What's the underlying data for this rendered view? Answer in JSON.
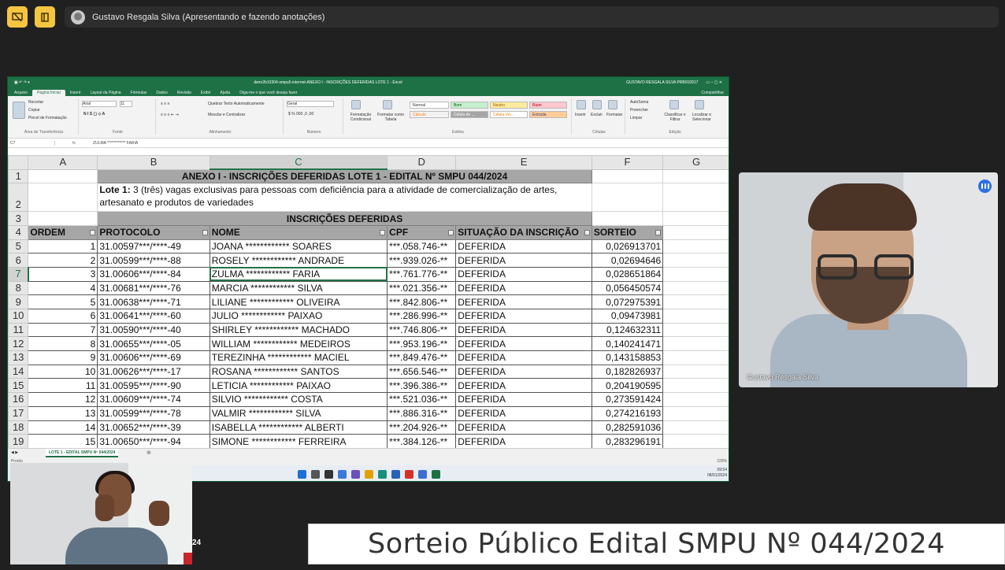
{
  "meeting": {
    "presenter_label": "Gustavo Resgala Silva (Apresentando e fazendo anotações)",
    "presenter_cam_name": "Gustavo Resgala Silva",
    "banner_text": "Sorteio Público Edital SMPU  Nº 044/2024",
    "side_label": "24"
  },
  "excel": {
    "title": "dsmr2b10304-smpu5-internet-ANEXO I - INSCRIÇÕES DEFERIDAS LOTE 1 - Excel",
    "user": "GUSTAVO RESGALA SILVA PRB010917",
    "tabs": [
      "Arquivo",
      "Página Inicial",
      "Inserir",
      "Layout da Página",
      "Fórmulas",
      "Dados",
      "Revisão",
      "Exibir",
      "Ajuda",
      "Diga-me o que você deseja fazer"
    ],
    "share": "Compartilhar",
    "ribbon": {
      "clipboard": [
        "Recortar",
        "Copiar",
        "Pincel de Formatação"
      ],
      "clipboard_cap": "Área de Transferência",
      "font_name": "Arial",
      "font_size": "11",
      "font_cap": "Fonte",
      "wrap": "Quebrar Texto Automaticamente",
      "merge": "Mesclar e Centralizar",
      "align_cap": "Alinhamento",
      "number_format": "Geral",
      "number_cap": "Número",
      "cond_format": "Formatação Condicional",
      "format_table": "Formatar como Tabela",
      "styles": [
        "Normal",
        "Bom",
        "Neutro",
        "Ruim",
        "Cálculo",
        "Célula de ...",
        "Célula Vin...",
        "Entrada"
      ],
      "styles_cap": "Estilos",
      "cells": [
        "Inserir",
        "Excluir",
        "Formatar"
      ],
      "cells_cap": "Células",
      "edit": [
        "AutoSoma",
        "Preencher",
        "Limpar",
        "Classificar e Filtrar",
        "Localizar e Selecionar"
      ],
      "edit_cap": "Edição"
    },
    "name_box": "C7",
    "fx": "fx",
    "formula": "ZULMA ************ FARIA",
    "columns": [
      "A",
      "B",
      "C",
      "D",
      "E",
      "F",
      "G"
    ],
    "row_numbers": [
      "1",
      "2",
      "3",
      "4",
      "5",
      "6",
      "7",
      "8",
      "9",
      "10",
      "11",
      "12",
      "13",
      "14",
      "15",
      "16",
      "17",
      "18",
      "19"
    ],
    "title_row": "ANEXO I - INSCRIÇÕES DEFERIDAS LOTE 1 - EDITAL Nº SMPU 044/2024",
    "lote_label": "Lote 1:",
    "lote_text": "3 (três) vagas exclusivas para pessoas com deficiência para a atividade de comercialização de artes, artesanato e produtos de variedades",
    "band": "INSCRIÇÕES DEFERIDAS",
    "headers": [
      "ORDEM",
      "PROTOCOLO",
      "NOME",
      "CPF",
      "SITUAÇÃO DA INSCRIÇÃO",
      "SORTEIO"
    ],
    "rows": [
      [
        "1",
        "31.00597***/****-49",
        "JOANA ************ SOARES",
        "***.058.746-**",
        "DEFERIDA",
        "0,026913701"
      ],
      [
        "2",
        "31.00599***/****-88",
        "ROSELY ************ ANDRADE",
        "***.939.026-**",
        "DEFERIDA",
        "0,02694646"
      ],
      [
        "3",
        "31.00606***/****-84",
        "ZULMA ************ FARIA",
        "***.761.776-**",
        "DEFERIDA",
        "0,028651864"
      ],
      [
        "4",
        "31.00681***/****-76",
        "MARCIA ************ SILVA",
        "***.021.356-**",
        "DEFERIDA",
        "0,056450574"
      ],
      [
        "5",
        "31.00638***/****-71",
        "LILIANE ************ OLIVEIRA",
        "***.842.806-**",
        "DEFERIDA",
        "0,072975391"
      ],
      [
        "6",
        "31.00641***/****-60",
        "JULIO ************ PAIXAO",
        "***.286.996-**",
        "DEFERIDA",
        "0,09473981"
      ],
      [
        "7",
        "31.00590***/****-40",
        "SHIRLEY ************ MACHADO",
        "***.746.806-**",
        "DEFERIDA",
        "0,124632311"
      ],
      [
        "8",
        "31.00655***/****-05",
        "WILLIAM ************ MEDEIROS",
        "***.953.196-**",
        "DEFERIDA",
        "0,140241471"
      ],
      [
        "9",
        "31.00606***/****-69",
        "TEREZINHA ************ MACIEL",
        "***.849.476-**",
        "DEFERIDA",
        "0,143158853"
      ],
      [
        "10",
        "31.00626***/****-17",
        "ROSANA ************ SANTOS",
        "***.656.546-**",
        "DEFERIDA",
        "0,182826937"
      ],
      [
        "11",
        "31.00595***/****-90",
        "LETICIA ************ PAIXAO",
        "***.396.386-**",
        "DEFERIDA",
        "0,204190595"
      ],
      [
        "12",
        "31.00609***/****-74",
        "SILVIO ************ COSTA",
        "***.521.036-**",
        "DEFERIDA",
        "0,273591424"
      ],
      [
        "13",
        "31.00599***/****-78",
        "VALMIR ************ SILVA",
        "***.886.316-**",
        "DEFERIDA",
        "0,274216193"
      ],
      [
        "14",
        "31.00652***/****-39",
        "ISABELLA ************ ALBERTI",
        "***.204.926-**",
        "DEFERIDA",
        "0,282591036"
      ],
      [
        "15",
        "31.00650***/****-94",
        "SIMONE ************ FERREIRA",
        "***.384.126-**",
        "DEFERIDA",
        "0,283296191"
      ]
    ],
    "sheet_tab": "LOTE 1 - EDITAL SMPU Nº 044/2024",
    "status_left": "Pronto",
    "zoom": "220%",
    "clock_time": "09:54",
    "clock_date": "08/01/2024",
    "colors": {
      "excel_green": "#1e7145",
      "header_gray": "#a6a6a6",
      "mic_blue": "#2f6fe2",
      "yellow_btn": "#f5c542"
    }
  }
}
